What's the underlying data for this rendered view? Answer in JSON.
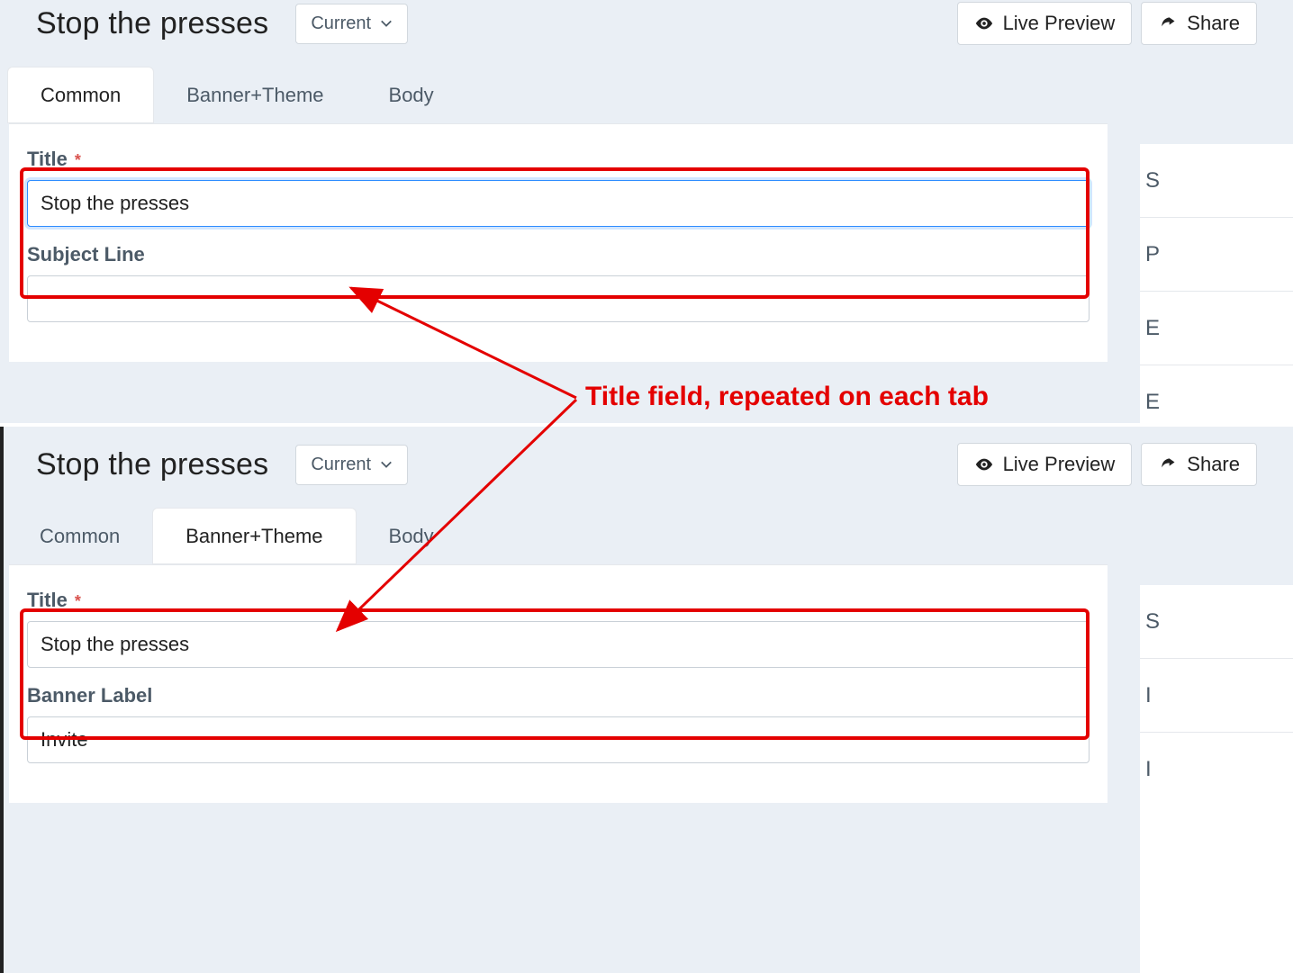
{
  "annotation": {
    "text": "Title field, repeated on each tab"
  },
  "panels": [
    {
      "id": "top",
      "pageTitle": "Stop the presses",
      "dropdownLabel": "Current",
      "livePreviewLabel": "Live Preview",
      "shareLabel": "Share",
      "tabs": [
        {
          "label": "Common",
          "active": true
        },
        {
          "label": "Banner+Theme",
          "active": false
        },
        {
          "label": "Body",
          "active": false
        }
      ],
      "fields": [
        {
          "label": "Title",
          "required": true,
          "value": "Stop the presses",
          "focused": true
        },
        {
          "label": "Subject Line",
          "required": false,
          "value": "",
          "focused": false
        }
      ],
      "sideStubs": [
        "S",
        "P",
        "E",
        "E"
      ]
    },
    {
      "id": "bottom",
      "pageTitle": "Stop the presses",
      "dropdownLabel": "Current",
      "livePreviewLabel": "Live Preview",
      "shareLabel": "Share",
      "tabs": [
        {
          "label": "Common",
          "active": false
        },
        {
          "label": "Banner+Theme",
          "active": true
        },
        {
          "label": "Body",
          "active": false
        }
      ],
      "fields": [
        {
          "label": "Title",
          "required": true,
          "value": "Stop the presses",
          "focused": false
        },
        {
          "label": "Banner Label",
          "required": false,
          "value": "Invite",
          "focused": false
        }
      ],
      "sideStubs": [
        "S",
        "I",
        "I"
      ]
    }
  ]
}
